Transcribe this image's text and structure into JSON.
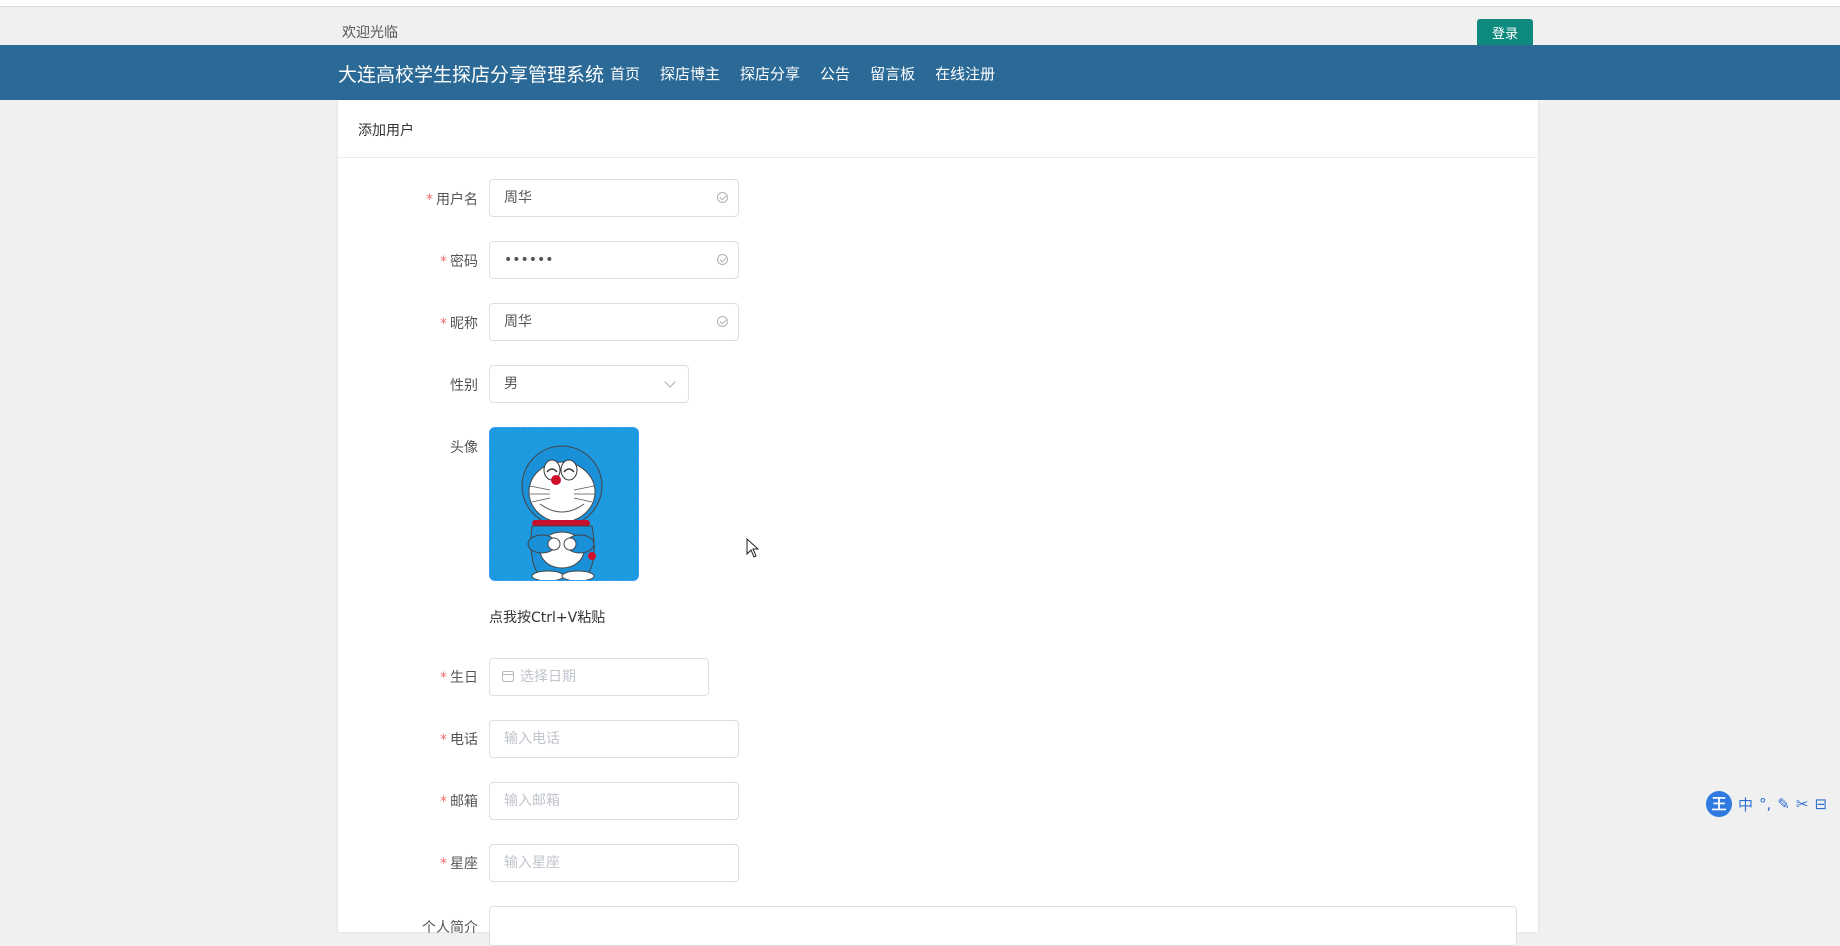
{
  "header": {
    "welcome": "欢迎光临",
    "login_label": "登录"
  },
  "nav": {
    "brand": "大连高校学生探店分享管理系统",
    "links": [
      "首页",
      "探店博主",
      "探店分享",
      "公告",
      "留言板",
      "在线注册"
    ]
  },
  "form": {
    "title": "添加用户",
    "required_mark": "*",
    "username": {
      "label": "用户名",
      "value": "周华"
    },
    "password": {
      "label": "密码",
      "value": "••••••"
    },
    "nickname": {
      "label": "昵称",
      "value": "周华"
    },
    "gender": {
      "label": "性别",
      "value": "男"
    },
    "avatar": {
      "label": "头像",
      "paste_tip": "点我按Ctrl+V粘贴"
    },
    "birthday": {
      "label": "生日",
      "placeholder": "选择日期"
    },
    "phone": {
      "label": "电话",
      "placeholder": "输入电话"
    },
    "email": {
      "label": "邮箱",
      "placeholder": "输入邮箱"
    },
    "zodiac": {
      "label": "星座",
      "placeholder": "输入星座"
    },
    "bio": {
      "label": "个人简介"
    }
  },
  "ime": {
    "logo": "王",
    "items": [
      "中",
      "°,",
      "✎",
      "✂",
      "⊟"
    ]
  },
  "colors": {
    "nav_bg": "#2b6a96",
    "login_bg": "#0f8a7e",
    "required": "#f56c6c"
  }
}
